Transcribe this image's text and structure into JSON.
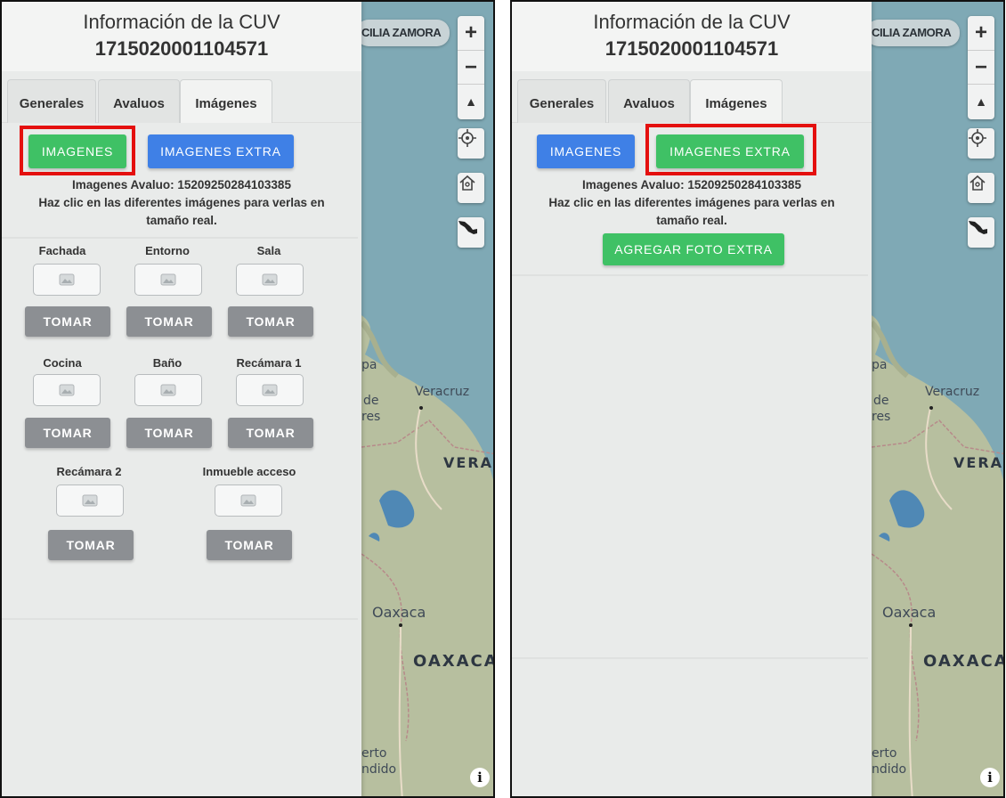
{
  "header": {
    "title": "Información de la CUV",
    "cuv": "1715020001104571"
  },
  "tabs": [
    "Generales",
    "Avaluos",
    "Imágenes"
  ],
  "active_tab": "Imágenes",
  "buttons": {
    "imagenes": "IMAGENES",
    "imagenes_extra": "IMAGENES EXTRA",
    "agregar_foto_extra": "AGREGAR FOTO EXTRA",
    "tomar": "TOMAR"
  },
  "info": {
    "avaluo": "Imagenes Avaluo: 15209250284103385",
    "hint_line1": "Haz clic en las diferentes imágenes para verlas en",
    "hint_line2": "tamaño real."
  },
  "photo_slots": [
    "Fachada",
    "Entorno",
    "Sala",
    "Cocina",
    "Baño",
    "Recámara 1",
    "Recámara 2",
    "Inmueble acceso"
  ],
  "map": {
    "owner_chip": "CILIA ZAMORA",
    "labels": [
      "pa",
      "de",
      "res",
      "Veracruz",
      "VERAC",
      "Oaxaca",
      "OAXACA",
      "erto",
      "ndido"
    ],
    "colors": {
      "sea": "#7fa9b5",
      "land": "#b7bf9f",
      "lake": "#4f88b5"
    }
  },
  "colors": {
    "green": "#3fc165",
    "blue": "#3f80e6",
    "gray_button": "#8c8f93",
    "highlight": "#e4100f"
  }
}
